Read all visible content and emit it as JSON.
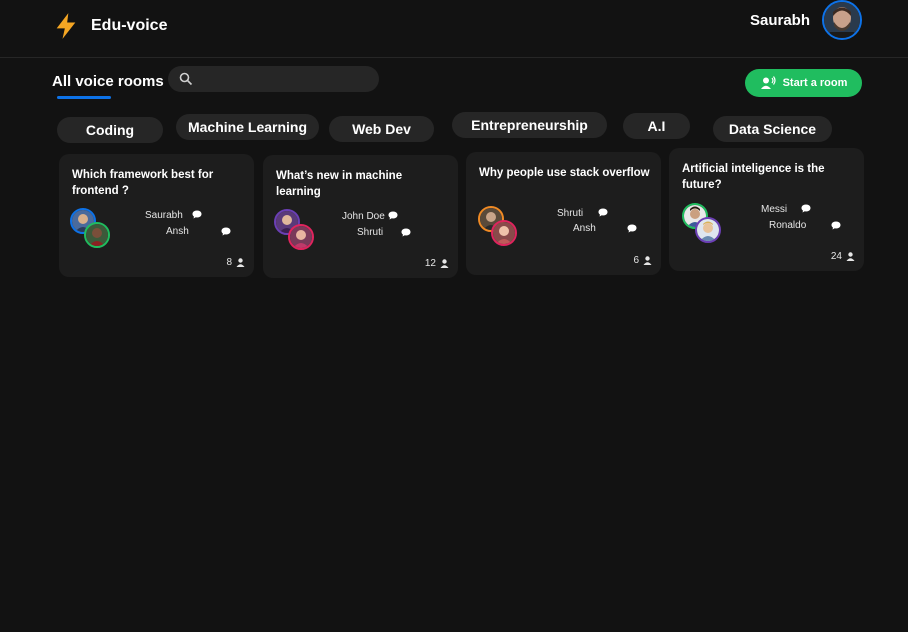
{
  "brand": {
    "name": "Edu-voice",
    "logo_icon": "lightning-bolt-icon",
    "logo_color": "#f5a623"
  },
  "user": {
    "name": "Saurabh"
  },
  "rooms_header": {
    "title": "All voice rooms"
  },
  "search": {
    "placeholder": "",
    "value": ""
  },
  "start_room": {
    "label": "Start a room",
    "icon": "voice-user-icon"
  },
  "categories": [
    "Coding",
    "Machine Learning",
    "Web Dev",
    "Entrepreneurship",
    "A.I",
    "Data Science"
  ],
  "rooms": [
    {
      "topic": "Which framework best for frontend ?",
      "speakers": [
        "Saurabh",
        "Ansh"
      ],
      "listeners": "8"
    },
    {
      "topic": "What’s new in machine learning",
      "speakers": [
        "John Doe",
        "Shruti"
      ],
      "listeners": "12"
    },
    {
      "topic": "Why people use stack overflow",
      "speakers": [
        "Shruti",
        "Ansh"
      ],
      "listeners": "6"
    },
    {
      "topic": "Artificial inteligence is the future?",
      "speakers": [
        "Messi",
        "Ronaldo"
      ],
      "listeners": "24"
    }
  ],
  "colors": {
    "accent_blue": "#0d72e8",
    "accent_green": "#20bd5f",
    "background": "#121212",
    "card": "#1d1d1d"
  }
}
